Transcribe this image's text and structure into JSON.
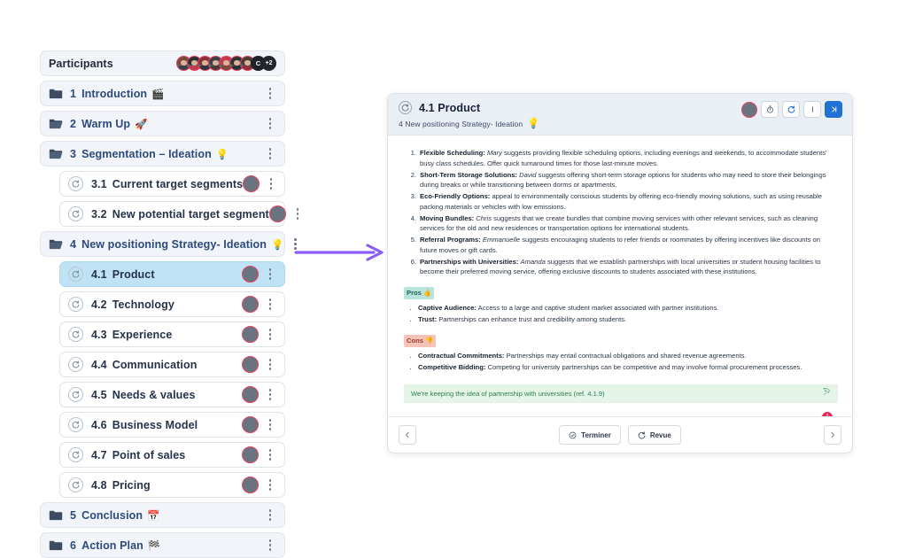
{
  "sidebar": {
    "participants": {
      "label": "Participants",
      "extra_count": "+2",
      "initial_avatar": "C",
      "avatar_count": 8
    },
    "items": [
      {
        "num": "1",
        "title": "Introduction",
        "emoji": "🎬",
        "type": "section",
        "icon": "folder-closed-icon",
        "selected": false,
        "avatar": false
      },
      {
        "num": "2",
        "title": "Warm Up",
        "emoji": "🚀",
        "type": "section",
        "icon": "folder-open-icon",
        "selected": false,
        "avatar": false
      },
      {
        "num": "3",
        "title": "Segmentation – Ideation",
        "emoji": "💡",
        "type": "section",
        "icon": "folder-open-icon",
        "selected": false,
        "avatar": false
      },
      {
        "num": "3.1",
        "title": "Current target segments",
        "emoji": "",
        "type": "sub",
        "icon": "refresh-icon",
        "selected": false,
        "avatar": true
      },
      {
        "num": "3.2",
        "title": "New potential target segment",
        "emoji": "",
        "type": "sub",
        "icon": "refresh-icon",
        "selected": false,
        "avatar": true
      },
      {
        "num": "4",
        "title": "New positioning Strategy- Ideation",
        "emoji": "💡",
        "type": "section",
        "icon": "folder-open-icon",
        "selected": false,
        "avatar": false
      },
      {
        "num": "4.1",
        "title": "Product",
        "emoji": "",
        "type": "sub",
        "icon": "refresh-icon",
        "selected": true,
        "avatar": true
      },
      {
        "num": "4.2",
        "title": "Technology",
        "emoji": "",
        "type": "sub",
        "icon": "refresh-icon",
        "selected": false,
        "avatar": true
      },
      {
        "num": "4.3",
        "title": "Experience",
        "emoji": "",
        "type": "sub",
        "icon": "refresh-icon",
        "selected": false,
        "avatar": true
      },
      {
        "num": "4.4",
        "title": "Communication",
        "emoji": "",
        "type": "sub",
        "icon": "refresh-icon",
        "selected": false,
        "avatar": true
      },
      {
        "num": "4.5",
        "title": "Needs & values",
        "emoji": "",
        "type": "sub",
        "icon": "refresh-icon",
        "selected": false,
        "avatar": true
      },
      {
        "num": "4.6",
        "title": "Business Model",
        "emoji": "",
        "type": "sub",
        "icon": "refresh-icon",
        "selected": false,
        "avatar": true
      },
      {
        "num": "4.7",
        "title": "Point of sales",
        "emoji": "",
        "type": "sub",
        "icon": "refresh-icon",
        "selected": false,
        "avatar": true
      },
      {
        "num": "4.8",
        "title": "Pricing",
        "emoji": "",
        "type": "sub",
        "icon": "refresh-icon",
        "selected": false,
        "avatar": true
      },
      {
        "num": "5",
        "title": "Conclusion",
        "emoji": "📅",
        "type": "section",
        "icon": "folder-closed-icon",
        "selected": false,
        "avatar": false
      },
      {
        "num": "6",
        "title": "Action Plan",
        "emoji": "🏁",
        "type": "section",
        "icon": "folder-closed-icon",
        "selected": false,
        "avatar": false
      }
    ]
  },
  "panel": {
    "header": {
      "title": "4.1 Product",
      "breadcrumb": "4 New positioning Strategy- Ideation",
      "breadcrumb_emoji": "💡",
      "actions": [
        {
          "name": "presenter-avatar",
          "type": "avatar"
        },
        {
          "name": "timer-icon",
          "type": "button"
        },
        {
          "name": "refresh-icon",
          "type": "button"
        },
        {
          "name": "pause-icon",
          "type": "button"
        },
        {
          "name": "next-step-icon",
          "type": "button",
          "accent": true
        }
      ]
    },
    "ideas": [
      {
        "term": "Flexible Scheduling",
        "sep": ":",
        "author": "Mary",
        "text": " suggests providing flexible scheduling options, including evenings and weekends, to accommodate students' busy class schedules. Offer quick turnaround times for those last-minute moves."
      },
      {
        "term": "Short-Term Storage Solutions",
        "sep": ":",
        "author": "David",
        "text": " suggests offering short-term storage options for students who may need to store their belongings during breaks or while transitioning between dorms or apartments."
      },
      {
        "term": "Eco-Friendly Options",
        "sep": ":",
        "author": "",
        "text": " appeal to environmentally conscious students by offering eco-friendly moving solutions, such as using reusable packing materials or vehicles with low emissions."
      },
      {
        "term": "Moving Bundles",
        "sep": ":",
        "author": "Chris",
        "text": " suggests that we create bundles that combine moving services with other relevant services, such as cleaning services for the old and new residences or transportation options for international students."
      },
      {
        "term": "Referral Programs",
        "sep": ":",
        "author": "Emmanuelle",
        "text": " suggests encouraging students to refer friends or roommates by offering incentives like discounts on future moves or gift cards."
      },
      {
        "term": "Partnerships with Universities",
        "sep": ":",
        "author": "Amanda",
        "text": " suggests that we establish partnerships with local universities or student housing facilities to become their preferred moving service, offering exclusive discounts to students associated with these institutions."
      }
    ],
    "pros": {
      "label": "Pros",
      "emoji": "👍",
      "items": [
        {
          "term": "Captive Audience:",
          "text": " Access to a large and captive student market associated with partner institutions."
        },
        {
          "term": "Trust:",
          "text": " Partnerships can enhance trust and credibility among students."
        }
      ]
    },
    "cons": {
      "label": "Cons",
      "emoji": "👎",
      "items": [
        {
          "term": "Contractual Commitments:",
          "text": " Partnerships may entail contractual obligations and shared revenue agreements."
        },
        {
          "term": "Competitive Bidding:",
          "text": " Competing for university partnerships can be competitive and may involve formal procurement processes."
        }
      ]
    },
    "note": {
      "text": "We're keeping the idea of partnership with universities (ref. 4.1.9)"
    },
    "badge": {
      "value": "!"
    },
    "footer": {
      "prev_label": "",
      "next_label": "",
      "finish_label": "Terminer",
      "review_label": "Revue"
    }
  },
  "colors": {
    "accent_blue": "#1f72d4",
    "selected_row": "#bfe3f5",
    "arrow_purple": "#8b5cf6",
    "pros_bg": "#b8e4dd",
    "cons_bg": "#f6c3b8",
    "note_bg": "#e4f5e8",
    "note_text": "#2e7d4f",
    "badge_red": "#e8265a",
    "avatar_ring": "#e8415e"
  }
}
